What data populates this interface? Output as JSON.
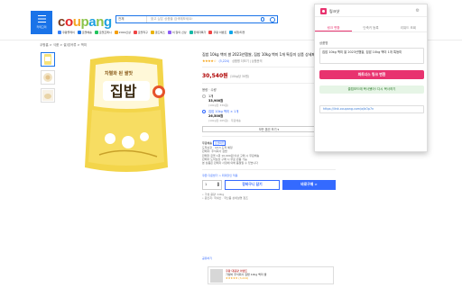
{
  "header": {
    "menu_label": "카테고리",
    "logo_letters": [
      {
        "ch": "c",
        "color": "#7f3b1c"
      },
      {
        "ch": "o",
        "color": "#e52528"
      },
      {
        "ch": "u",
        "color": "#f5a623"
      },
      {
        "ch": "p",
        "color": "#8bc34a"
      },
      {
        "ch": "a",
        "color": "#1fa0e0"
      },
      {
        "ch": "n",
        "color": "#8bc34a"
      },
      {
        "ch": "g",
        "color": "#1fa0e0"
      }
    ],
    "search_category": "전체",
    "search_placeholder": "찾고 싶은 상품을 검색해보세요!",
    "nav_items": [
      {
        "label": "쿠팡플레이",
        "color": "#3b82f6"
      },
      {
        "label": "로켓배송",
        "color": "#1a73e8"
      },
      {
        "label": "로켓프레시",
        "color": "#22c55e"
      },
      {
        "label": "2024신상",
        "color": "#f59e0b"
      },
      {
        "label": "로켓직구",
        "color": "#ef4444"
      },
      {
        "label": "골드박스",
        "color": "#eab308"
      },
      {
        "label": "이 달의 신상",
        "color": "#8b5cf6"
      },
      {
        "label": "판매자특가",
        "color": "#14b8a6"
      },
      {
        "label": "쿠팡 이벤트",
        "color": "#ef4444"
      },
      {
        "label": "여행/티켓",
        "color": "#0ea5e9"
      }
    ]
  },
  "breadcrumb": "쿠팡홈 > 식품 > 쌀/잡곡류 > 백미",
  "product": {
    "title": "집밥 10kg 백미 쌀 2023년햅쌀, 집밥 10kg 백미 1개 특등미 상품 상세페이지 참조",
    "stars": "★★★★☆",
    "rating_count": "(3,224)",
    "qa": "상품평 더보기 | 상품문의",
    "image_text": "집밥",
    "image_top_text": "차별화 된 쌀맛",
    "price": "30,540원",
    "unit_price": "(10kg당 30원)",
    "option_header": "용량 · 수량",
    "options": [
      {
        "name": "1개",
        "price": "33,900원",
        "sub": "(10kg당 339원)"
      },
      {
        "name": "집밥 10kg 백미 × 1개",
        "price": "26,500원",
        "sub": "(10kg당 265원) · 무료배송"
      }
    ],
    "more_options": "모든 옵션 보기 ▾",
    "shipping_lines": [
      "무료배송",
      "도착보장 · 4/13 도착 예정",
      "판매자: 주식회사 집밥",
      "판매자 로켓 1회 10,000원 이상 구매 시 무료배송",
      "판매자 도착보장 구매 시 무료 반품 가능",
      "본 상품은 판매자 사정에 의해 품절될 수 있습니다"
    ],
    "ship_tag": "로켓와우",
    "coupon": "쿠폰 다운받기 > 최대할인 적용",
    "quantity": "1",
    "add_cart": "장바구니 담기",
    "buy_now": "바로구매 >",
    "bullets": [
      "• 가성 용량: 10kg",
      "• 원산지: 국내산 · 국산품 상세설명 참조"
    ],
    "share": "공유하기"
  },
  "banner": {
    "line1": "쿠팡 대용량 이벤트",
    "line2": "가성비 주식회사 집밥 10kg 백미 쌀",
    "line3": "★★★★★ (3,224)"
  },
  "popup": {
    "title": "링크샷",
    "tabs": [
      "링크 변환",
      "단축키 등록",
      "리워드 조회"
    ],
    "label": "상품명",
    "textarea_value": "집밥 10kg 백미 쌀 2023년햅쌀, 집밥 10kg 백미 1개 특등미",
    "primary_button": "파트너스 링크 변환",
    "secondary_button": "클립보드에 복사됐어! 다시 복사하기",
    "result_link": "https://link.coupang.com/a/bOp7n"
  }
}
